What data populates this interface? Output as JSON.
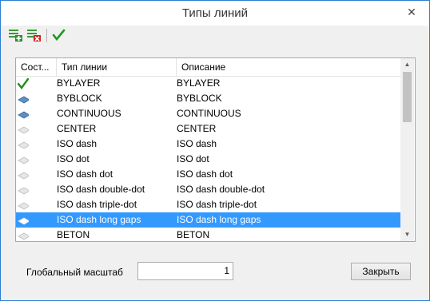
{
  "window": {
    "title": "Типы линий",
    "close_glyph": "✕"
  },
  "toolbar": {
    "buttons": [
      {
        "name": "add-linetype-button",
        "icon": "linetype-add-icon",
        "accent": "#2e8b2e"
      },
      {
        "name": "delete-linetype-button",
        "icon": "linetype-delete-icon",
        "accent": "#d02020"
      },
      {
        "name": "apply-button",
        "icon": "checkmark-icon",
        "accent": "#1f9a1f"
      }
    ]
  },
  "grid": {
    "columns": [
      "Сост...",
      "Тип линии",
      "Описание"
    ],
    "rows": [
      {
        "state": "current",
        "type": "BYLAYER",
        "desc": "BYLAYER"
      },
      {
        "state": "used",
        "type": "BYBLOCK",
        "desc": "BYBLOCK"
      },
      {
        "state": "used",
        "type": "CONTINUOUS",
        "desc": "CONTINUOUS"
      },
      {
        "state": "unused",
        "type": "CENTER",
        "desc": "CENTER"
      },
      {
        "state": "unused",
        "type": "ISO dash",
        "desc": "ISO dash"
      },
      {
        "state": "unused",
        "type": "ISO dot",
        "desc": "ISO dot"
      },
      {
        "state": "unused",
        "type": "ISO dash dot",
        "desc": "ISO dash dot"
      },
      {
        "state": "unused",
        "type": "ISO dash double-dot",
        "desc": "ISO dash double-dot"
      },
      {
        "state": "unused",
        "type": "ISO dash triple-dot",
        "desc": "ISO dash triple-dot"
      },
      {
        "state": "selected",
        "type": "ISO dash long gaps",
        "desc": "ISO dash long gaps"
      },
      {
        "state": "unused",
        "type": "BETON",
        "desc": "BETON"
      }
    ],
    "selection_color": "#3399ff"
  },
  "footer": {
    "scale_label": "Глобальный масштаб",
    "scale_value": "1",
    "close_label": "Закрыть"
  }
}
